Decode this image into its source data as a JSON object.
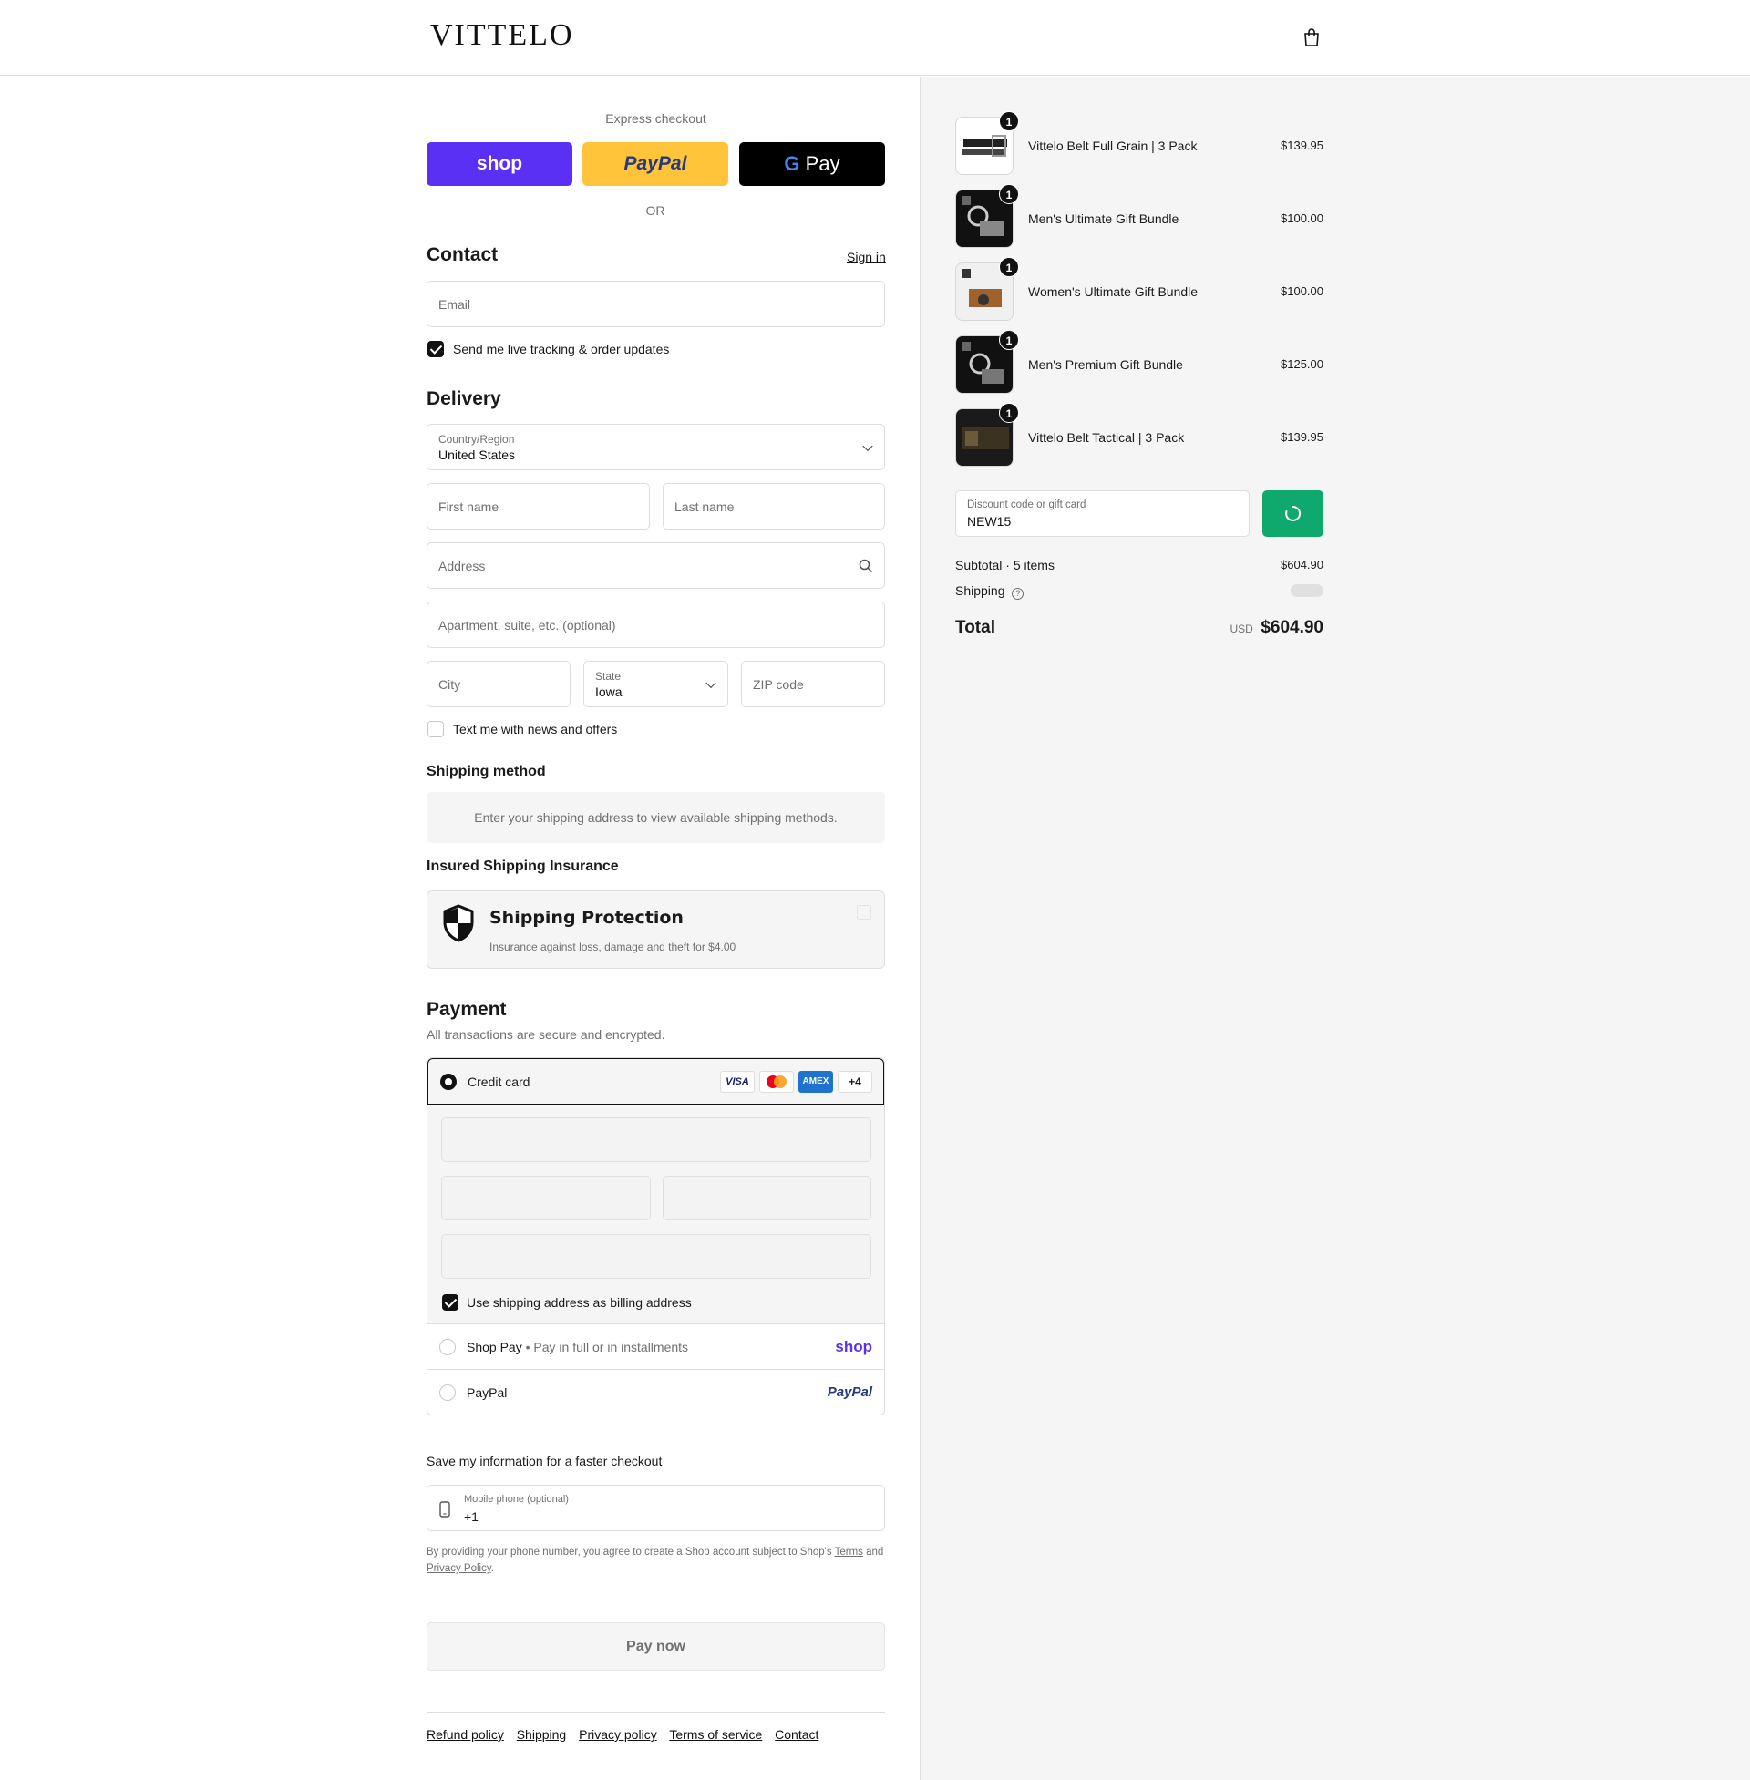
{
  "brand": {
    "logo_text": "VITTELO"
  },
  "express": {
    "title": "Express checkout",
    "shop_label": "shop",
    "paypal_label": "PayPal",
    "gpay_label": "Pay",
    "or_label": "OR"
  },
  "contact": {
    "title": "Contact",
    "sign_in": "Sign in",
    "email_placeholder": "Email",
    "tracking_label": "Send me live tracking & order updates"
  },
  "delivery": {
    "title": "Delivery",
    "country_label": "Country/Region",
    "country_value": "United States",
    "first_name": "First name",
    "last_name": "Last name",
    "address": "Address",
    "apartment": "Apartment, suite, etc. (optional)",
    "city": "City",
    "state_label": "State",
    "state_value": "Iowa",
    "zip": "ZIP code",
    "news_label": "Text me with news and offers"
  },
  "shipping_method": {
    "title": "Shipping method",
    "note": "Enter your shipping address to view available shipping methods."
  },
  "insurance": {
    "title": "Insured Shipping Insurance",
    "protection_title": "Shipping Protection",
    "protection_desc": "Insurance against loss, damage and theft for $4.00"
  },
  "payment": {
    "title": "Payment",
    "subtitle": "All transactions are secure and encrypted.",
    "credit_card": "Credit card",
    "card_logos": [
      "VISA",
      "MC",
      "AMEX",
      "+4"
    ],
    "billing_label": "Use shipping address as billing address",
    "shop_pay": "Shop Pay",
    "shop_pay_desc": "Pay in full or in installments",
    "shop_pay_logo": "shop",
    "paypal": "PayPal",
    "paypal_logo": "PayPal"
  },
  "save_info": {
    "title": "Save my information for a faster checkout",
    "phone_label": "Mobile phone (optional)",
    "phone_value": "+1",
    "legal_text": "By providing your phone number, you agree to create a Shop account subject to Shop's",
    "terms": "Terms",
    "and": "and",
    "privacy": "Privacy Policy"
  },
  "pay_now": "Pay now",
  "footer_links": [
    "Refund policy",
    "Shipping",
    "Privacy policy",
    "Terms of service",
    "Contact"
  ],
  "order": {
    "items": [
      {
        "name": "Vittelo Belt Full Grain | 3 Pack",
        "price": "$139.95",
        "qty": "1"
      },
      {
        "name": "Men's Ultimate Gift Bundle",
        "price": "$100.00",
        "qty": "1"
      },
      {
        "name": "Women's Ultimate Gift Bundle",
        "price": "$100.00",
        "qty": "1"
      },
      {
        "name": "Men's Premium Gift Bundle",
        "price": "$125.00",
        "qty": "1"
      },
      {
        "name": "Vittelo Belt Tactical | 3 Pack",
        "price": "$139.95",
        "qty": "1"
      }
    ],
    "discount_label": "Discount code or gift card",
    "discount_value": "NEW15",
    "subtotal_label": "Subtotal · 5 items",
    "subtotal_value": "$604.90",
    "shipping_label": "Shipping",
    "total_label": "Total",
    "currency": "USD",
    "total_value": "$604.90"
  },
  "colors": {
    "shop_purple": "#5a31f4",
    "paypal_yellow": "#ffc439",
    "gpay_black": "#000000",
    "discount_green": "#0fa96d"
  }
}
